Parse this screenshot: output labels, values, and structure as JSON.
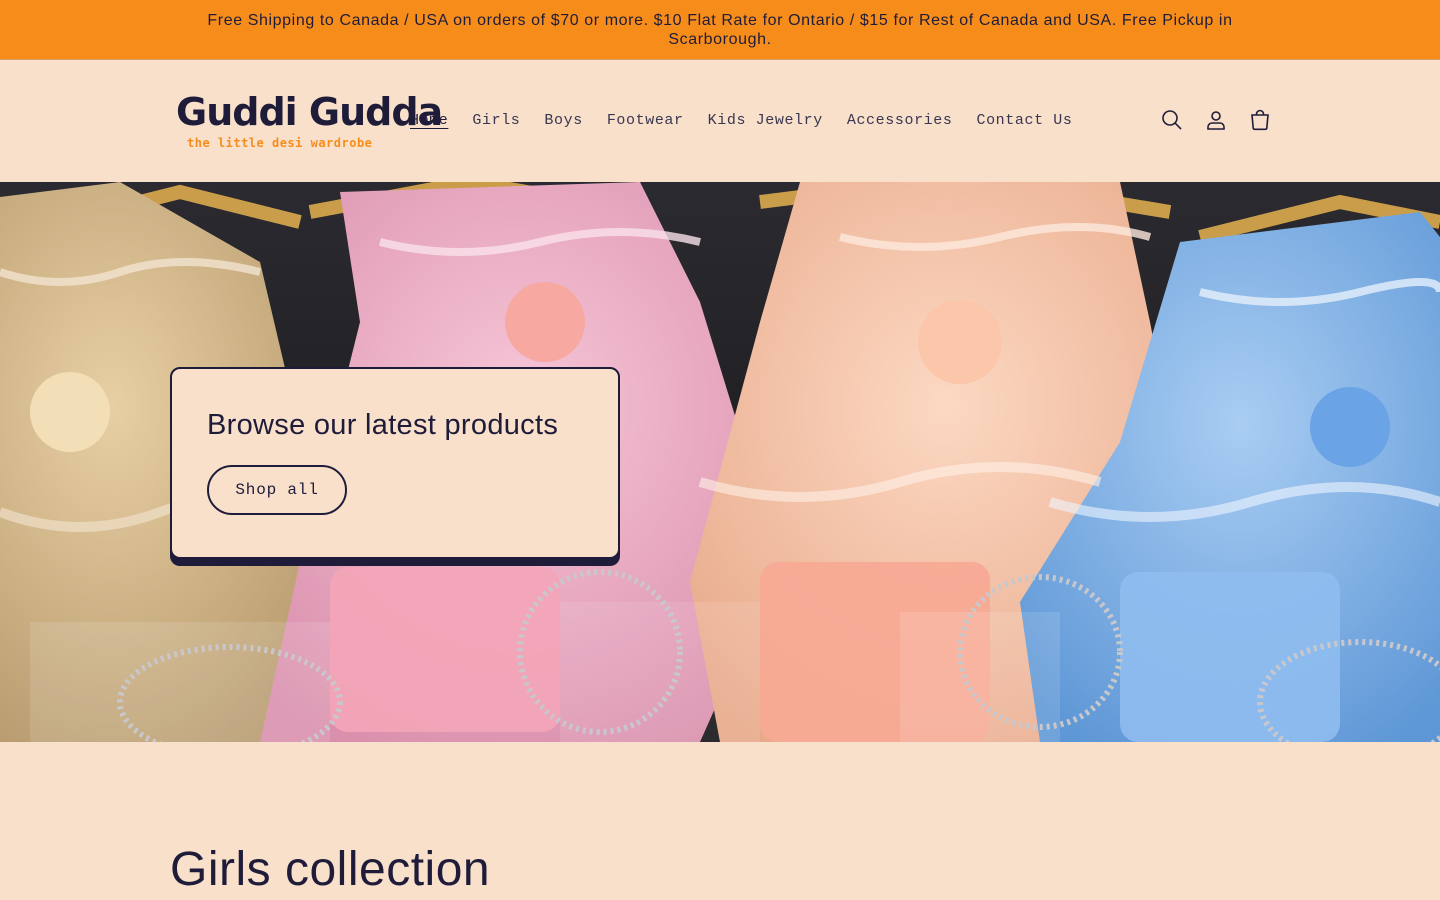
{
  "announcement": {
    "text": "Free Shipping to Canada / USA on orders of $70 or more. $10 Flat Rate for Ontario / $15 for Rest of Canada and USA. Free Pickup in Scarborough."
  },
  "header": {
    "logo_title": "Guddi Gudda",
    "logo_tagline": "the little desi wardrobe",
    "nav": [
      {
        "label": "Home",
        "active": true
      },
      {
        "label": "Girls"
      },
      {
        "label": "Boys"
      },
      {
        "label": "Footwear"
      },
      {
        "label": "Kids Jewelry"
      },
      {
        "label": "Accessories"
      },
      {
        "label": "Contact Us"
      }
    ],
    "icons": [
      "search-icon",
      "account-icon",
      "cart-icon"
    ]
  },
  "hero": {
    "heading": "Browse our latest products",
    "button_label": "Shop all"
  },
  "collection": {
    "title": "Girls collection"
  },
  "colors": {
    "announcement_bg": "#f68d1b",
    "page_bg": "#f8e0cb",
    "text": "#1f1c3a",
    "accent": "#f68d1b"
  }
}
